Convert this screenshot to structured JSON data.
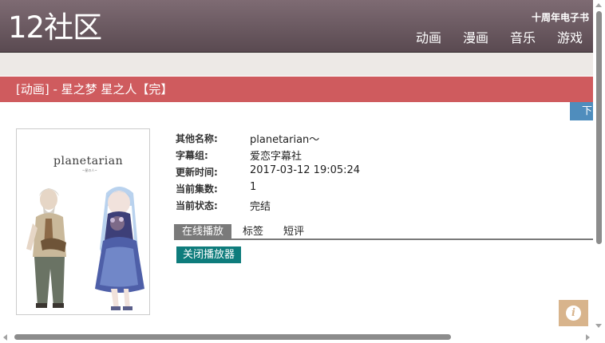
{
  "header": {
    "logo": "12社区",
    "anniversary_link": "十周年电子书",
    "nav": [
      "动画",
      "漫画",
      "音乐",
      "游戏"
    ]
  },
  "page_title": "[动画] - 星之梦 星之人【完】",
  "download_tab_label": "下",
  "poster": {
    "title": "planetarian",
    "subtitle": "~星の人~"
  },
  "info": [
    {
      "label": "其他名称:",
      "value": "planetarian～"
    },
    {
      "label": "字幕组:",
      "value": "爱恋字幕社"
    },
    {
      "label": "更新时间:",
      "value": "2017-03-12 19:05:24"
    },
    {
      "label": "当前集数:",
      "value": "1"
    },
    {
      "label": "当前状态:",
      "value": "完结"
    }
  ],
  "tabs": [
    "在线播放",
    "标签",
    "短评"
  ],
  "active_tab": "在线播放",
  "player_button": "关闭播放器",
  "info_button_icon": "info-icon",
  "colors": {
    "header": "#6c5a62",
    "title_bar": "#cf5b5e",
    "player_button": "#0e7c7c",
    "download_tab": "#4f8dbd",
    "info_button": "#d8b48c"
  }
}
